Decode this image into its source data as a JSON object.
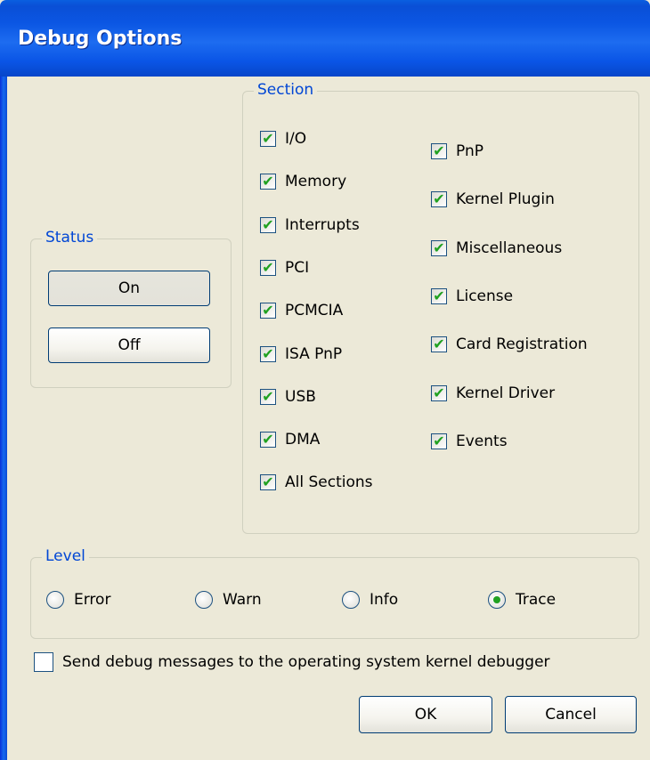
{
  "window": {
    "title": "Debug Options"
  },
  "status": {
    "legend": "Status",
    "on_label": "On",
    "off_label": "Off",
    "selected": "On"
  },
  "section": {
    "legend": "Section",
    "left_items": [
      {
        "label": "I/O",
        "checked": true
      },
      {
        "label": "Memory",
        "checked": true
      },
      {
        "label": "Interrupts",
        "checked": true
      },
      {
        "label": "PCI",
        "checked": true
      },
      {
        "label": "PCMCIA",
        "checked": true
      },
      {
        "label": "ISA PnP",
        "checked": true
      },
      {
        "label": "USB",
        "checked": true
      },
      {
        "label": "DMA",
        "checked": true
      },
      {
        "label": "All Sections",
        "checked": true
      }
    ],
    "right_items": [
      {
        "label": "PnP",
        "checked": true
      },
      {
        "label": "Kernel Plugin",
        "checked": true
      },
      {
        "label": "Miscellaneous",
        "checked": true
      },
      {
        "label": "License",
        "checked": true
      },
      {
        "label": "Card Registration",
        "checked": true
      },
      {
        "label": "Kernel Driver",
        "checked": true
      },
      {
        "label": "Events",
        "checked": true
      }
    ]
  },
  "level": {
    "legend": "Level",
    "options": [
      {
        "label": "Error",
        "selected": false
      },
      {
        "label": "Warn",
        "selected": false
      },
      {
        "label": "Info",
        "selected": false
      },
      {
        "label": "Trace",
        "selected": true
      }
    ]
  },
  "kernel_debugger": {
    "label": "Send debug messages to the operating system kernel debugger",
    "checked": false
  },
  "buttons": {
    "ok": "OK",
    "cancel": "Cancel"
  },
  "colors": {
    "accent": "#0046d5",
    "check": "#21a121",
    "titlebar": "#0a55e6"
  }
}
